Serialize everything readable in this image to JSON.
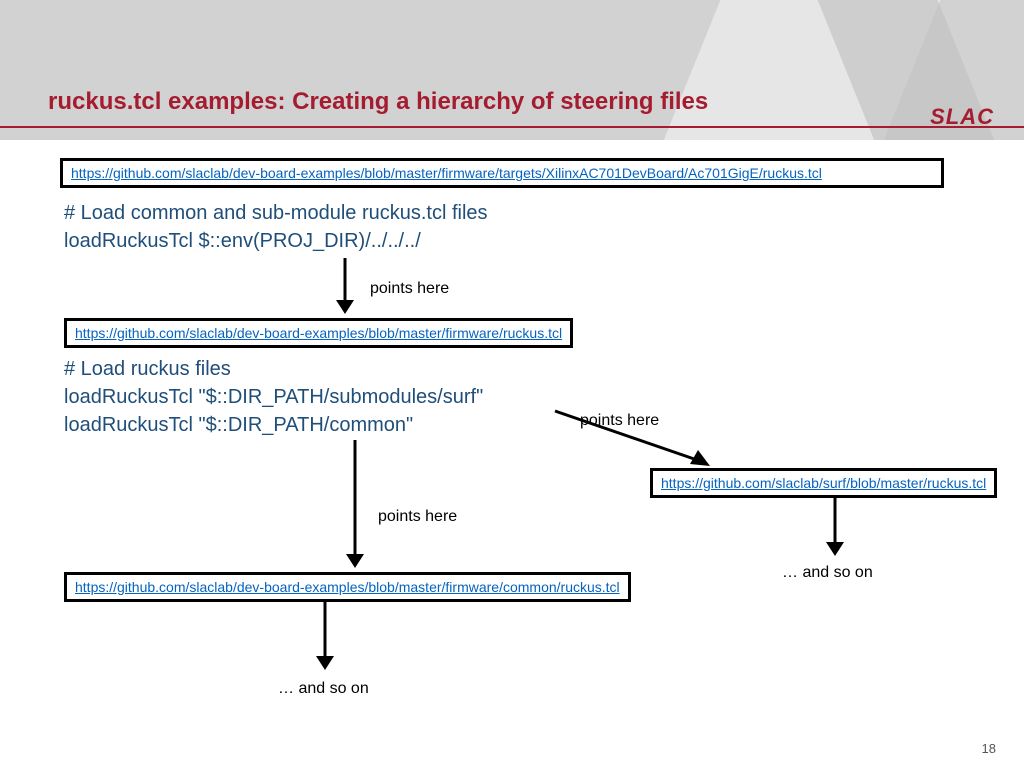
{
  "title": "ruckus.tcl examples: Creating a hierarchy of steering files",
  "logo": "SLAC",
  "link1": "https://github.com/slaclab/dev-board-examples/blob/master/firmware/targets/XilinxAC701DevBoard/Ac701GigE/ruckus.tcl",
  "code1a": "# Load common and sub-module ruckus.tcl files",
  "code1b": "loadRuckusTcl $::env(PROJ_DIR)/../../../",
  "points1": "points here",
  "link2": "https://github.com/slaclab/dev-board-examples/blob/master/firmware/ruckus.tcl",
  "code2a": "# Load ruckus files",
  "code2b": "loadRuckusTcl \"$::DIR_PATH/submodules/surf\"",
  "code2c": "loadRuckusTcl \"$::DIR_PATH/common\"",
  "points2": "points here",
  "points3": "points here",
  "link3": "https://github.com/slaclab/surf/blob/master/ruckus.tcl",
  "soon1": "… and so on",
  "link4": "https://github.com/slaclab/dev-board-examples/blob/master/firmware/common/ruckus.tcl",
  "soon2": "… and so on",
  "pagenum": "18"
}
